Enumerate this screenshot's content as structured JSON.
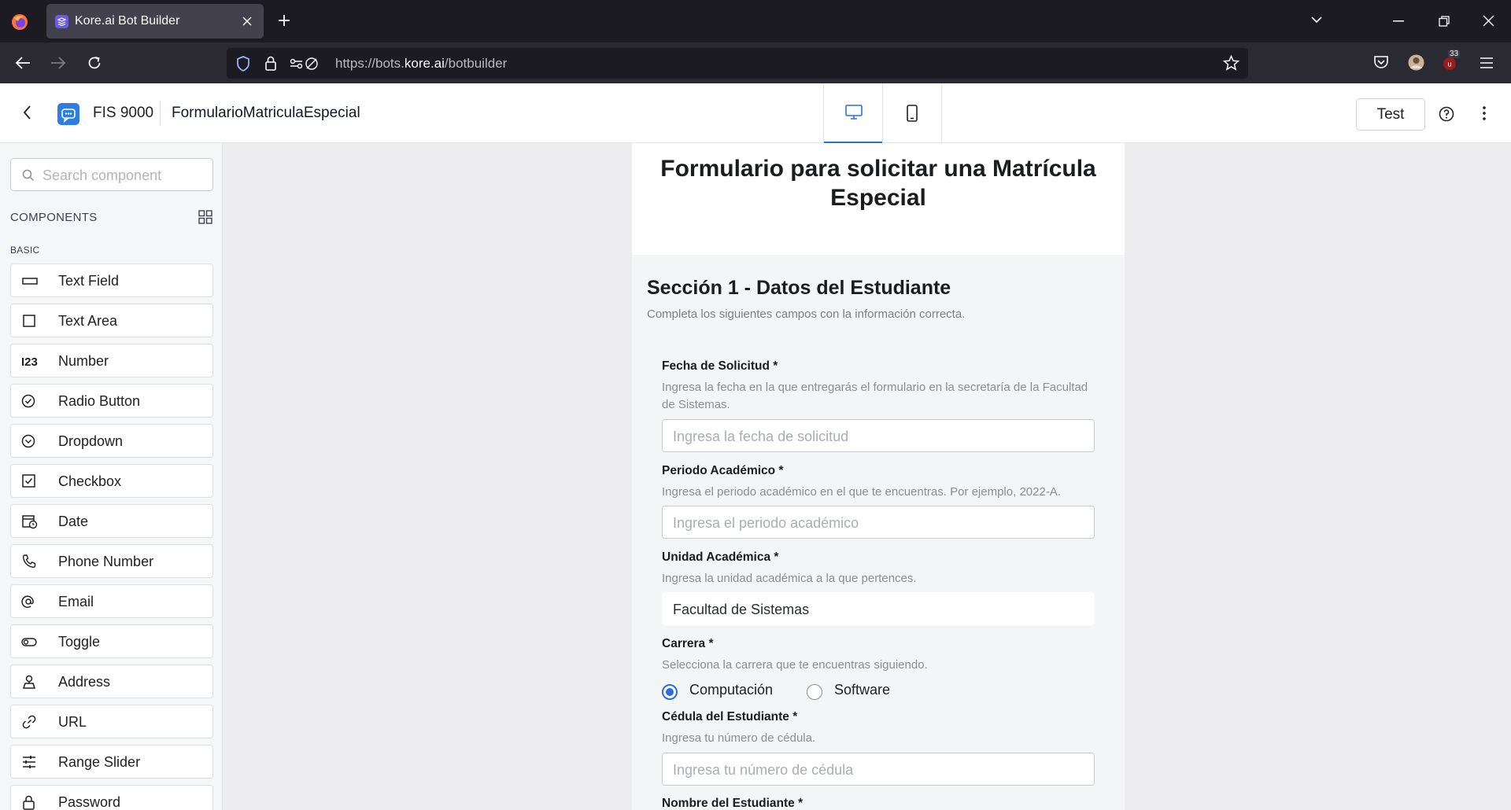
{
  "browser": {
    "tab_title": "Kore.ai Bot Builder",
    "url_prefix": "https://bots.",
    "url_domain": "kore.ai",
    "url_path": "/botbuilder",
    "notification_count": "33"
  },
  "header": {
    "bot_name": "FIS 9000",
    "form_name": "FormularioMatriculaEspecial",
    "test_label": "Test"
  },
  "sidebar": {
    "search_placeholder": "Search component",
    "components_label": "COMPONENTS",
    "basic_label": "BASIC",
    "items": [
      {
        "label": "Text Field",
        "icon": "text-field-icon"
      },
      {
        "label": "Text Area",
        "icon": "text-area-icon"
      },
      {
        "label": "Number",
        "icon": "number-icon"
      },
      {
        "label": "Radio Button",
        "icon": "radio-button-icon"
      },
      {
        "label": "Dropdown",
        "icon": "dropdown-icon"
      },
      {
        "label": "Checkbox",
        "icon": "checkbox-icon"
      },
      {
        "label": "Date",
        "icon": "date-icon"
      },
      {
        "label": "Phone Number",
        "icon": "phone-icon"
      },
      {
        "label": "Email",
        "icon": "email-icon"
      },
      {
        "label": "Toggle",
        "icon": "toggle-icon"
      },
      {
        "label": "Address",
        "icon": "address-icon"
      },
      {
        "label": "URL",
        "icon": "url-icon"
      },
      {
        "label": "Range Slider",
        "icon": "range-slider-icon"
      },
      {
        "label": "Password",
        "icon": "password-icon"
      }
    ]
  },
  "form": {
    "title": "Formulario para solicitar una Matrícula Especial",
    "section_title": "Sección 1 - Datos del Estudiante",
    "section_desc": "Completa los siguientes campos con la información correcta.",
    "fields": [
      {
        "label": "Fecha de Solicitud *",
        "help": "Ingresa la fecha en la que entregarás el formulario en la secretaría de la Facultad de Sistemas.",
        "placeholder": "Ingresa la fecha de solicitud"
      },
      {
        "label": "Periodo Académico *",
        "help": "Ingresa el periodo académico en el que te encuentras. Por ejemplo, 2022-A.",
        "placeholder": "Ingresa el periodo académico"
      },
      {
        "label": "Unidad Académica *",
        "help": "Ingresa la unidad académica a la que pertences.",
        "value": "Facultad de Sistemas"
      },
      {
        "label": "Carrera *",
        "help": "Selecciona la carrera que te encuentras siguiendo.",
        "options": [
          "Computación",
          "Software"
        ],
        "selected": "Computación"
      },
      {
        "label": "Cédula del Estudiante *",
        "help": "Ingresa tu número de cédula.",
        "placeholder": "Ingresa tu número de cédula"
      },
      {
        "label": "Nombre del Estudiante *"
      }
    ]
  },
  "colors": {
    "accent": "#2b6de1",
    "browser_dark": "#1c1b22",
    "browser_toolbar": "#2b2a33"
  }
}
